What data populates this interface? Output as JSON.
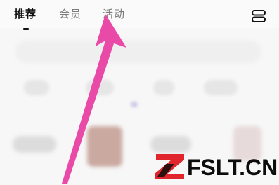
{
  "tabs": [
    {
      "label": "推荐",
      "active": true
    },
    {
      "label": "会员",
      "active": false
    },
    {
      "label": "活动",
      "active": false
    }
  ],
  "watermark": {
    "text": "FSLT.CN"
  },
  "colors": {
    "arrow": "#e94aa8",
    "watermark_red": "#e0252c",
    "active_tab": "#111111",
    "inactive_tab": "#7a7a7a"
  },
  "icons": {
    "menu": "menu-icon",
    "arrow": "pointer-arrow"
  }
}
